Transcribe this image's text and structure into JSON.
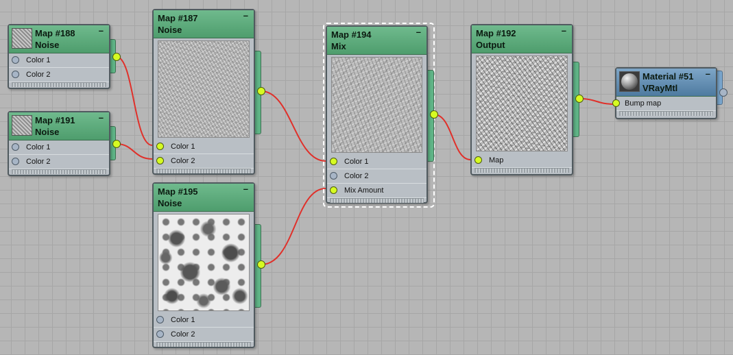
{
  "nodes": {
    "n188": {
      "title": "Map #188",
      "type": "Noise",
      "inputs": [
        "Color 1",
        "Color 2"
      ]
    },
    "n191": {
      "title": "Map #191",
      "type": "Noise",
      "inputs": [
        "Color 1",
        "Color 2"
      ]
    },
    "n187": {
      "title": "Map #187",
      "type": "Noise",
      "inputs": [
        "Color 1",
        "Color 2"
      ]
    },
    "n195": {
      "title": "Map #195",
      "type": "Noise",
      "inputs": [
        "Color 1",
        "Color 2"
      ]
    },
    "n194": {
      "title": "Map #194",
      "type": "Mix",
      "inputs": [
        "Color 1",
        "Color 2",
        "Mix Amount"
      ]
    },
    "n192": {
      "title": "Map #192",
      "type": "Output",
      "inputs": [
        "Map"
      ]
    },
    "m51": {
      "title": "Material #51",
      "type": "VRayMtl",
      "inputs": [
        "Bump map"
      ]
    }
  },
  "minimize_glyph": "–",
  "colors": {
    "canvas": "#b6b6b6",
    "map_header": "#5faa7c",
    "material_header": "#6690b6",
    "wire": "#e0302a",
    "connected_socket": "#d6fb22",
    "empty_socket": "#a7b5c6"
  },
  "icons": {
    "minimize": "minimize-icon",
    "noise_thumb": "noise-thumbnail-icon",
    "material_thumb": "sphere-material-icon"
  }
}
